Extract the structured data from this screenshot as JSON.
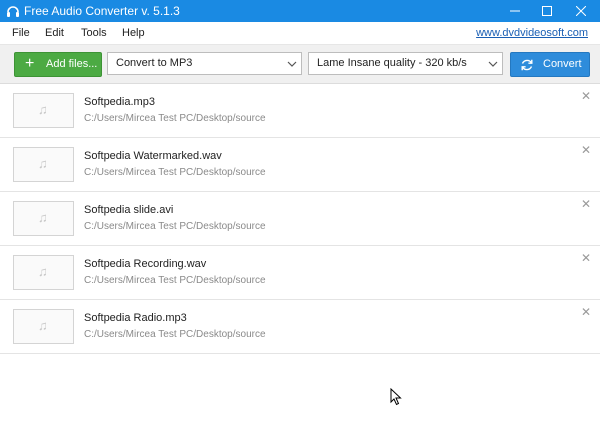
{
  "window": {
    "title": "Free Audio Converter v. 5.1.3",
    "accent": "#1a8ae3"
  },
  "menu": {
    "items": [
      "File",
      "Edit",
      "Tools",
      "Help"
    ],
    "site_link": "www.dvdvideosoft.com"
  },
  "toolbar": {
    "add_label": "Add files...",
    "format_value": "Convert to MP3",
    "quality_value": "Lame Insane quality - 320 kb/s",
    "convert_label": "Convert"
  },
  "files": [
    {
      "name": "Softpedia.mp3",
      "path": "C:/Users/Mircea Test PC/Desktop/source"
    },
    {
      "name": "Softpedia Watermarked.wav",
      "path": "C:/Users/Mircea Test PC/Desktop/source"
    },
    {
      "name": "Softpedia slide.avi",
      "path": "C:/Users/Mircea Test PC/Desktop/source"
    },
    {
      "name": "Softpedia Recording.wav",
      "path": "C:/Users/Mircea Test PC/Desktop/source"
    },
    {
      "name": "Softpedia Radio.mp3",
      "path": "C:/Users/Mircea Test PC/Desktop/source"
    }
  ],
  "glyphs": {
    "note": "♫",
    "close": "✕",
    "plus": "+"
  }
}
